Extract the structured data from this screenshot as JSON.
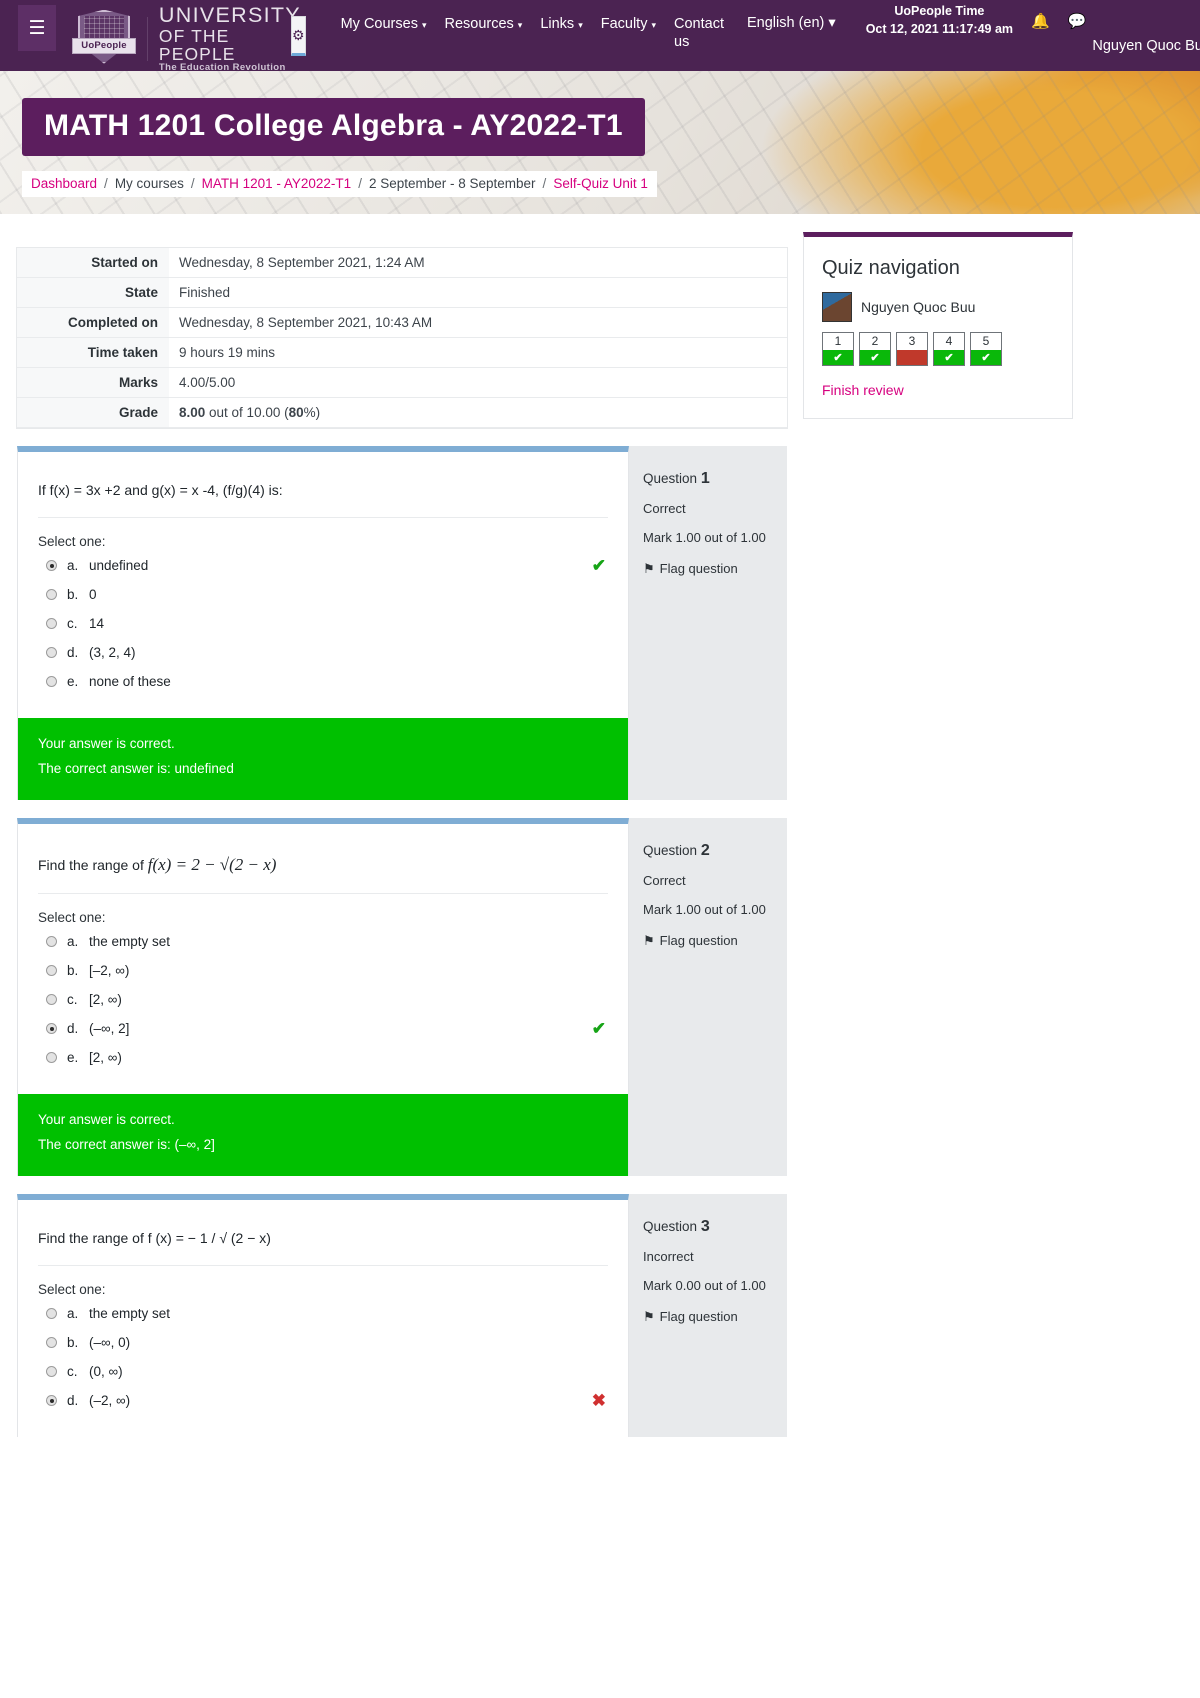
{
  "navbar": {
    "menu_icon": "hamburger-icon",
    "logo": {
      "ribbon": "UoPeople",
      "line1": "UNIVERSITY",
      "line2": "OF THE PEOPLE",
      "line3": "The Education Revolution"
    },
    "gear_icon": "gear-icon",
    "links": [
      {
        "label": "My Courses",
        "caret": "▾"
      },
      {
        "label": "Resources",
        "caret": "▾"
      },
      {
        "label": "Links",
        "caret": "▾"
      },
      {
        "label": "Faculty",
        "caret": "▾"
      },
      {
        "label": "Contact us",
        "caret": ""
      }
    ],
    "language": "English (en)",
    "language_caret": "▾",
    "uopeople_time_label": "UoPeople Time",
    "uopeople_time_value": "Oct 12, 2021 11:17:49 am",
    "bell_icon": "🔔",
    "chat_icon": "💬",
    "user_name": "Nguyen Quoc Buu",
    "user_caret": "▾"
  },
  "hero": {
    "title": "MATH 1201 College Algebra - AY2022-T1",
    "breadcrumb": [
      {
        "label": "Dashboard",
        "link": true
      },
      {
        "label": "My courses",
        "link": false
      },
      {
        "label": "MATH 1201 - AY2022-T1",
        "link": true
      },
      {
        "label": "2 September - 8 September",
        "link": false
      },
      {
        "label": "Self-Quiz Unit 1",
        "link": true
      }
    ],
    "separator": "/"
  },
  "summary": {
    "rows": [
      {
        "label": "Started on",
        "value": "Wednesday, 8 September 2021, 1:24 AM",
        "bold_prefix": "",
        "suffix": ""
      },
      {
        "label": "State",
        "value": "Finished",
        "bold_prefix": "",
        "suffix": ""
      },
      {
        "label": "Completed on",
        "value": "Wednesday, 8 September 2021, 10:43 AM",
        "bold_prefix": "",
        "suffix": ""
      },
      {
        "label": "Time taken",
        "value": "9 hours 19 mins",
        "bold_prefix": "",
        "suffix": ""
      },
      {
        "label": "Marks",
        "value": "4.00/5.00",
        "bold_prefix": "",
        "suffix": ""
      }
    ],
    "grade_label": "Grade",
    "grade_bold": "8.00",
    "grade_mid": " out of 10.00 (",
    "grade_pct": "80",
    "grade_end": "%)"
  },
  "questions": [
    {
      "text": "If f(x) = 3x +2 and g(x) = x -4, (f/g)(4) is:",
      "is_math": false,
      "select_label": "Select one:",
      "options": [
        {
          "letter": "a.",
          "text": "undefined",
          "selected": true,
          "mark": "ok"
        },
        {
          "letter": "b.",
          "text": "0",
          "selected": false,
          "mark": ""
        },
        {
          "letter": "c.",
          "text": "14",
          "selected": false,
          "mark": ""
        },
        {
          "letter": "d.",
          "text": "(3, 2, 4)",
          "selected": false,
          "mark": ""
        },
        {
          "letter": "e.",
          "text": "none of these",
          "selected": false,
          "mark": ""
        }
      ],
      "feedback_line1": "Your answer is correct.",
      "feedback_line2": "The correct answer is: undefined",
      "info": {
        "question_label": "Question",
        "number": "1",
        "state": "Correct",
        "mark": "Mark 1.00 out of 1.00",
        "flag_label": "Flag question",
        "flag_icon": "⚑"
      }
    },
    {
      "text": "Find the range of ",
      "math": "f(x) = 2 − √(2 − x)",
      "is_math": true,
      "select_label": "Select one:",
      "options": [
        {
          "letter": "a.",
          "text": "the empty set",
          "selected": false,
          "mark": ""
        },
        {
          "letter": "b.",
          "text": "[–2, ∞)",
          "selected": false,
          "mark": ""
        },
        {
          "letter": "c.",
          "text": "[2, ∞)",
          "selected": false,
          "mark": ""
        },
        {
          "letter": "d.",
          "text": "(–∞, 2]",
          "selected": true,
          "mark": "ok"
        },
        {
          "letter": "e.",
          "text": "[2, ∞)",
          "selected": false,
          "mark": ""
        }
      ],
      "feedback_line1": "Your answer is correct.",
      "feedback_line2": "The correct answer is: (–∞, 2]",
      "info": {
        "question_label": "Question",
        "number": "2",
        "state": "Correct",
        "mark": "Mark 1.00 out of 1.00",
        "flag_label": "Flag question",
        "flag_icon": "⚑"
      }
    },
    {
      "text": "Find the range of f (x) = − 1 / √ (2 − x)",
      "is_math": false,
      "select_label": "Select one:",
      "options": [
        {
          "letter": "a.",
          "text": "the empty set",
          "selected": false,
          "mark": ""
        },
        {
          "letter": "b.",
          "text": "(–∞, 0)",
          "selected": false,
          "mark": ""
        },
        {
          "letter": "c.",
          "text": "(0, ∞)",
          "selected": false,
          "mark": ""
        },
        {
          "letter": "d.",
          "text": "(–2, ∞)",
          "selected": true,
          "mark": "bad"
        }
      ],
      "feedback_line1": "",
      "feedback_line2": "",
      "info": {
        "question_label": "Question",
        "number": "3",
        "state": "Incorrect",
        "mark": "Mark 0.00 out of 1.00",
        "flag_label": "Flag question",
        "flag_icon": "⚑"
      }
    }
  ],
  "quiz_nav": {
    "title": "Quiz navigation",
    "user_name": "Nguyen Quoc Buu",
    "buttons": [
      {
        "num": "1",
        "state": "correct",
        "glyph": "✔"
      },
      {
        "num": "2",
        "state": "correct",
        "glyph": "✔"
      },
      {
        "num": "3",
        "state": "incorrect",
        "glyph": ""
      },
      {
        "num": "4",
        "state": "correct",
        "glyph": "✔"
      },
      {
        "num": "5",
        "state": "correct",
        "glyph": "✔"
      }
    ],
    "finish_review": "Finish review"
  },
  "colors": {
    "brand_purple": "#4b2352",
    "hero_purple": "#5c1e5e",
    "link_pink": "#d6007f",
    "feedback_green": "#00c000",
    "correct_green": "#0ab80a",
    "incorrect_red": "#c0392b",
    "question_top_blue": "#7fadd4"
  }
}
